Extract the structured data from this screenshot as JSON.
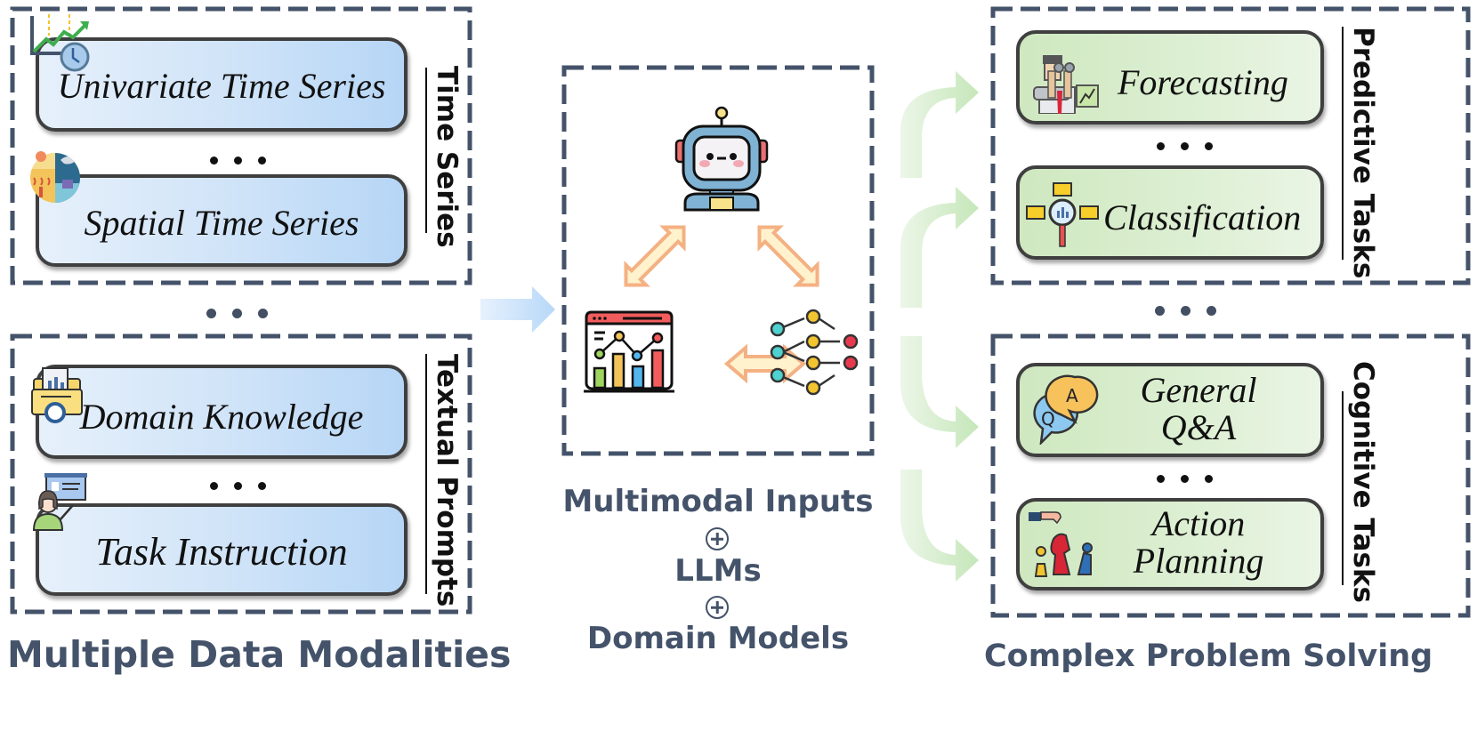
{
  "left_panel": {
    "title": "Multiple Data Modalities",
    "groups": [
      {
        "label": "Time Series",
        "items": [
          {
            "label": "Univariate Time Series",
            "icon": "line-chart-clock-icon"
          },
          {
            "label": "Spatial Time Series",
            "icon": "climate-globe-icon"
          }
        ]
      },
      {
        "label": "Textual Prompts",
        "items": [
          {
            "label": "Domain Knowledge",
            "icon": "document-folder-icon"
          },
          {
            "label": "Task Instruction",
            "icon": "teacher-presentation-icon"
          }
        ]
      }
    ],
    "ellipsis": "• • •"
  },
  "center_panel": {
    "icons": [
      "robot-icon",
      "dashboard-chart-icon",
      "neural-network-icon"
    ],
    "labels": [
      "Multimodal Inputs",
      "LLMs",
      "Domain Models"
    ],
    "operator": "⊕"
  },
  "right_panel": {
    "title": "Complex Problem Solving",
    "groups": [
      {
        "label": "Predictive Tasks",
        "items": [
          {
            "label": "Forecasting",
            "icon": "binoculars-analyst-icon"
          },
          {
            "label": "Classification",
            "icon": "magnifier-categories-icon"
          }
        ]
      },
      {
        "label": "Cognitive Tasks",
        "items": [
          {
            "label_line1": "General",
            "label_line2": "Q&A",
            "icon": "qa-chat-bubbles-icon"
          },
          {
            "label_line1": "Action",
            "label_line2": "Planning",
            "icon": "chess-pieces-icon"
          }
        ]
      }
    ]
  },
  "colors": {
    "dash_border": "#44536a",
    "blue_box_left": "#e6f0fb",
    "blue_box_right": "#b6d6f6",
    "green_box_left": "#cfe8c0",
    "green_box_right": "#eaf5e5",
    "orange_arrow": "#f4b183",
    "orange_arrow_fill": "#fff2cc",
    "title_text": "#44536a"
  }
}
